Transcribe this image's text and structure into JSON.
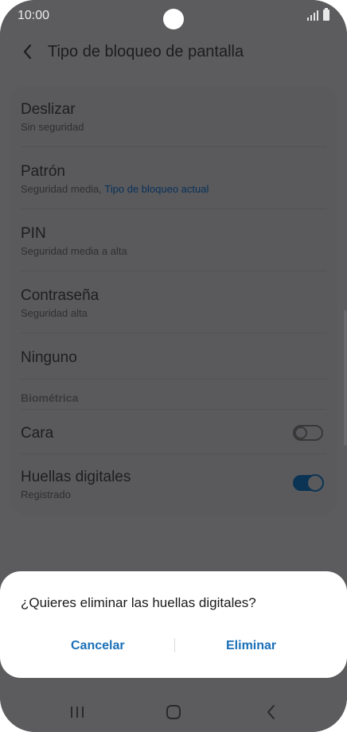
{
  "status_bar": {
    "time": "10:00"
  },
  "header": {
    "title": "Tipo de bloqueo de pantalla"
  },
  "options": [
    {
      "name": "Deslizar",
      "sub": "Sin seguridad"
    },
    {
      "name": "Patrón",
      "sub": "Seguridad media,",
      "sub_link": "Tipo de bloqueo actual"
    },
    {
      "name": "PIN",
      "sub": "Seguridad media a alta"
    },
    {
      "name": "Contraseña",
      "sub": "Seguridad alta"
    },
    {
      "name": "Ninguno"
    }
  ],
  "biometrics": {
    "label": "Biométrica",
    "face": {
      "name": "Cara",
      "enabled": false
    },
    "fingerprints": {
      "name": "Huellas digitales",
      "sub": "Registrado",
      "enabled": true
    }
  },
  "dialog": {
    "message": "¿Quieres eliminar las huellas digitales?",
    "cancel": "Cancelar",
    "remove": "Eliminar"
  },
  "colors": {
    "accent": "#1a70b8",
    "toggle_on": "#0a3354",
    "overlay": "#5c5c5e"
  },
  "nav_icons": [
    "recent-apps-icon",
    "home-icon",
    "back-icon"
  ]
}
